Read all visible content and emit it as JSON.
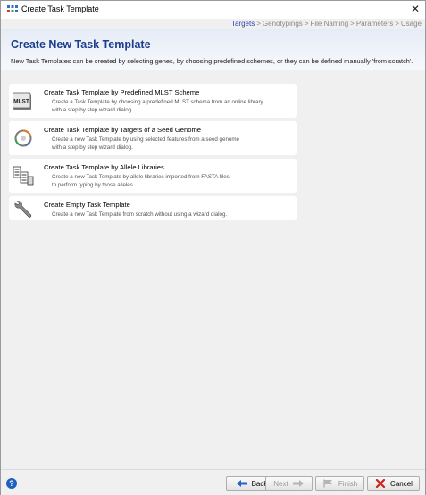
{
  "window": {
    "title": "Create Task Template"
  },
  "breadcrumb": {
    "steps": [
      "Targets",
      "Genotypings",
      "File Naming",
      "Parameters",
      "Usage"
    ],
    "separator": ">"
  },
  "header": {
    "title": "Create New Task Template",
    "description": "New Task Templates can be created by selecting genes, by choosing predefined schemes, or they can be defined manually 'from scratch'."
  },
  "options": [
    {
      "title": "Create Task Template by Predefined MLST Scheme",
      "desc_line1": "Create a Task Template by choosing a predefined MLST schema from an online library",
      "desc_line2": "with a step by step wizard dialog.",
      "icon": "mlst-icon",
      "icon_text": "MLST"
    },
    {
      "title": "Create Task Template by Targets of a Seed Genome",
      "desc_line1": "Create a new Task Template by using selected features from a seed genome",
      "desc_line2": "with a step by step wizard dialog.",
      "icon": "seed-genome-icon"
    },
    {
      "title": "Create Task Template by Allele Libraries",
      "desc_line1": "Create a new Task Template by allele libraries imported from FASTA files",
      "desc_line2": "to perform typing by those alleles.",
      "icon": "allele-library-icon"
    },
    {
      "title": "Create Empty Task Template",
      "desc_line1": "Create a new Task Template from scratch without using a wizard dialog.",
      "desc_line2": "",
      "icon": "wrench-icon"
    }
  ],
  "footer": {
    "back_label": "Back",
    "next_label": "Next",
    "finish_label": "Finish",
    "cancel_label": "Cancel"
  },
  "colors": {
    "accent": "#1b3d8c",
    "breadcrumb_active": "#2b3fa8",
    "cancel_red": "#d0201a",
    "back_blue": "#2a63c8"
  }
}
